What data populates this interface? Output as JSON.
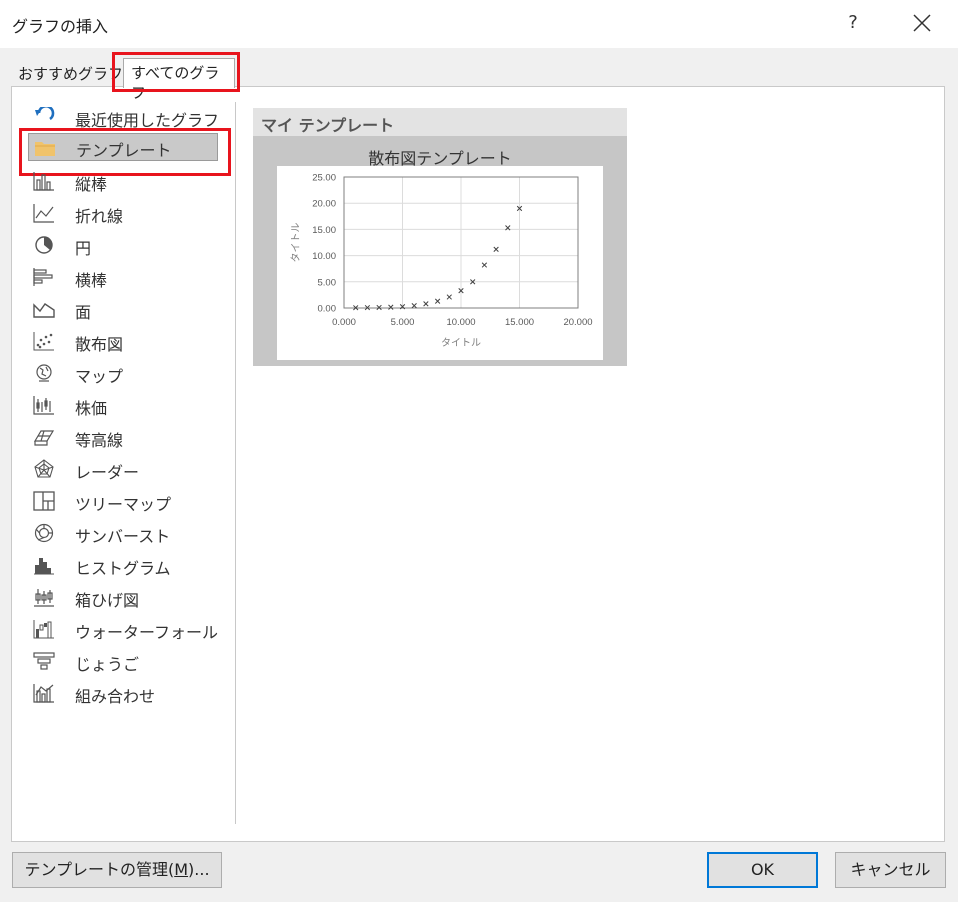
{
  "window": {
    "title": "グラフの挿入",
    "help": "?"
  },
  "tabs": [
    {
      "label": "おすすめグラフ"
    },
    {
      "label": "すべてのグラフ",
      "active": true
    }
  ],
  "sidebar": {
    "items": [
      {
        "label": "最近使用したグラフ",
        "icon": "recent-icon"
      },
      {
        "label": "テンプレート",
        "icon": "folder-icon",
        "selected": true
      },
      {
        "label": "縦棒",
        "icon": "column-chart-icon"
      },
      {
        "label": "折れ線",
        "icon": "line-chart-icon"
      },
      {
        "label": "円",
        "icon": "pie-chart-icon"
      },
      {
        "label": "横棒",
        "icon": "bar-chart-icon"
      },
      {
        "label": "面",
        "icon": "area-chart-icon"
      },
      {
        "label": "散布図",
        "icon": "scatter-chart-icon"
      },
      {
        "label": "マップ",
        "icon": "map-chart-icon"
      },
      {
        "label": "株価",
        "icon": "stock-chart-icon"
      },
      {
        "label": "等高線",
        "icon": "surface-chart-icon"
      },
      {
        "label": "レーダー",
        "icon": "radar-chart-icon"
      },
      {
        "label": "ツリーマップ",
        "icon": "treemap-chart-icon"
      },
      {
        "label": "サンバースト",
        "icon": "sunburst-chart-icon"
      },
      {
        "label": "ヒストグラム",
        "icon": "histogram-chart-icon"
      },
      {
        "label": "箱ひげ図",
        "icon": "boxplot-chart-icon"
      },
      {
        "label": "ウォーターフォール",
        "icon": "waterfall-chart-icon"
      },
      {
        "label": "じょうご",
        "icon": "funnel-chart-icon"
      },
      {
        "label": "組み合わせ",
        "icon": "combo-chart-icon"
      }
    ]
  },
  "main": {
    "section_title": "マイ テンプレート",
    "template_name": "散布図テンプレート"
  },
  "chart_data": {
    "type": "scatter",
    "title": "",
    "xlabel": "タイトル",
    "ylabel": "タイトル",
    "xlim": [
      0,
      20
    ],
    "ylim": [
      0,
      25
    ],
    "xticks": [
      "0.000",
      "5.000",
      "10.000",
      "15.000",
      "20.000"
    ],
    "yticks": [
      "0.00",
      "5.00",
      "10.00",
      "15.00",
      "20.00",
      "25.00"
    ],
    "grid": true,
    "marker": "x",
    "series": [
      {
        "x": [
          1,
          2,
          3,
          4,
          5,
          6,
          7,
          8,
          9,
          10,
          11,
          12,
          13,
          14,
          15
        ],
        "y": [
          0.05,
          0.07,
          0.1,
          0.15,
          0.25,
          0.45,
          0.8,
          1.3,
          2.1,
          3.3,
          5.0,
          8.2,
          11.2,
          15.3,
          19.0
        ]
      }
    ]
  },
  "buttons": {
    "manage_pre": "テンプレートの管理(",
    "manage_key": "M",
    "manage_post": ")...",
    "ok": "OK",
    "cancel": "キャンセル"
  },
  "colors": {
    "highlight": "#e8141d",
    "accent": "#0078d7",
    "recent_icon": "#1f6fbf",
    "folder_icon": "#f0c36b"
  }
}
